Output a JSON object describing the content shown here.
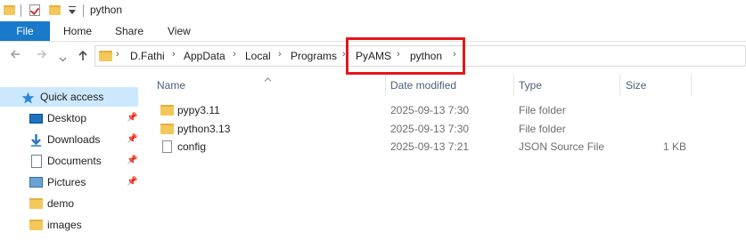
{
  "window": {
    "title": "python"
  },
  "ribbon": {
    "tabs": [
      "File",
      "Home",
      "Share",
      "View"
    ]
  },
  "address_bar": {
    "path": [
      "D.Fathi",
      "AppData",
      "Local",
      "Programs",
      "PyAMS",
      "python"
    ],
    "separator": "›"
  },
  "nav": {
    "back_icon": "left-arrow-icon",
    "forward_icon": "right-arrow-icon",
    "recent_icon": "chevron-down-icon",
    "up_icon": "up-arrow-icon"
  },
  "sidebar": {
    "items": [
      {
        "label": "Quick access",
        "icon": "star-icon",
        "pinned": false
      },
      {
        "label": "Desktop",
        "icon": "desktop-icon",
        "pinned": true
      },
      {
        "label": "Downloads",
        "icon": "download-icon",
        "pinned": true
      },
      {
        "label": "Documents",
        "icon": "document-icon",
        "pinned": true
      },
      {
        "label": "Pictures",
        "icon": "pictures-icon",
        "pinned": true
      },
      {
        "label": "demo",
        "icon": "folder-icon",
        "pinned": false
      },
      {
        "label": "images",
        "icon": "folder-icon",
        "pinned": false
      }
    ]
  },
  "file_list": {
    "columns": [
      "Name",
      "Date modified",
      "Type",
      "Size"
    ],
    "rows": [
      {
        "name": "pypy3.11",
        "date": "2025-09-13 7:30",
        "type": "File folder",
        "size": "",
        "icon": "folder-icon"
      },
      {
        "name": "python3.13",
        "date": "2025-09-13 7:30",
        "type": "File folder",
        "size": "",
        "icon": "folder-icon"
      },
      {
        "name": "config",
        "date": "2025-09-13 7:21",
        "type": "JSON Source File",
        "size": "1 KB",
        "icon": "file-icon"
      }
    ]
  },
  "colors": {
    "file_tab": "#1979ca",
    "selection": "#cce8ff",
    "highlight_box": "#e2181b",
    "folder": "#f2c85b"
  }
}
